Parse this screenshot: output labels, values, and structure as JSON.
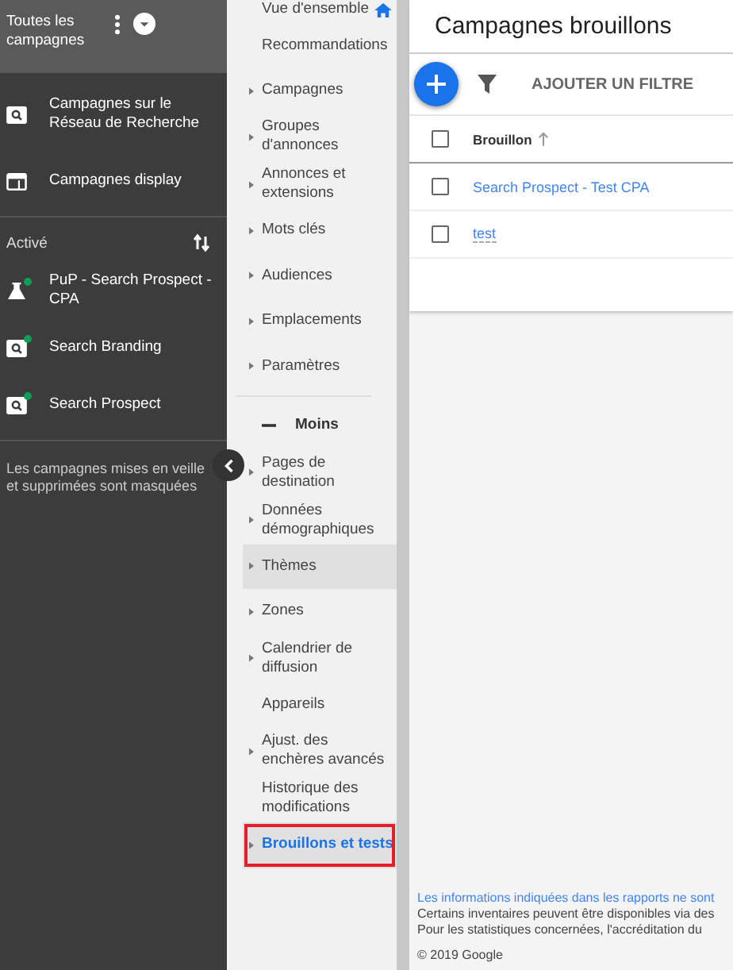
{
  "sidebar": {
    "title": "Toutes les campagnes",
    "types": [
      {
        "label": "Campagnes sur le Réseau de Recherche",
        "kind": "search"
      },
      {
        "label": "Campagnes display",
        "kind": "display"
      }
    ],
    "section": "Activé",
    "campaigns": [
      {
        "label": "PuP - Search Prospect - CPA",
        "kind": "experiment",
        "color": "#0f9d58"
      },
      {
        "label": "Search Branding",
        "kind": "search",
        "color": "#0f9d58"
      },
      {
        "label": "Search Prospect",
        "kind": "search",
        "color": "#0f9d58"
      }
    ],
    "note": "Les campagnes mises en veille et supprimées sont masquées"
  },
  "nav": {
    "items": [
      {
        "label": "Vue d'ensemble",
        "kind": "home",
        "expandable": false,
        "selected": false,
        "current": false
      },
      {
        "label": "Recommandations",
        "kind": "item",
        "expandable": false,
        "selected": false,
        "current": false
      },
      {
        "label": "Campagnes",
        "kind": "item",
        "expandable": true,
        "selected": false,
        "current": false
      },
      {
        "label": "Groupes d'annonces",
        "kind": "item",
        "expandable": true,
        "selected": false,
        "current": false
      },
      {
        "label": "Annonces et extensions",
        "kind": "item",
        "expandable": true,
        "selected": false,
        "current": false
      },
      {
        "label": "Mots clés",
        "kind": "item",
        "expandable": true,
        "selected": false,
        "current": false
      },
      {
        "label": "Audiences",
        "kind": "item",
        "expandable": true,
        "selected": false,
        "current": false
      },
      {
        "label": "Emplacements",
        "kind": "item",
        "expandable": true,
        "selected": false,
        "current": false
      },
      {
        "label": "Paramètres",
        "kind": "item",
        "expandable": true,
        "selected": false,
        "current": false
      },
      {
        "label": "Moins",
        "kind": "less",
        "expandable": false,
        "selected": false,
        "current": false
      },
      {
        "label": "Pages de destination",
        "kind": "item",
        "expandable": true,
        "selected": false,
        "current": false
      },
      {
        "label": "Données démographiques",
        "kind": "item",
        "expandable": true,
        "selected": false,
        "current": false
      },
      {
        "label": "Thèmes",
        "kind": "item",
        "expandable": true,
        "selected": true,
        "current": false
      },
      {
        "label": "Zones",
        "kind": "item",
        "expandable": true,
        "selected": false,
        "current": false
      },
      {
        "label": "Calendrier de diffusion",
        "kind": "item",
        "expandable": true,
        "selected": false,
        "current": false
      },
      {
        "label": "Appareils",
        "kind": "item",
        "expandable": false,
        "selected": false,
        "current": false
      },
      {
        "label": "Ajust. des enchères avancés",
        "kind": "item",
        "expandable": true,
        "selected": false,
        "current": false
      },
      {
        "label": "Historique des modifications",
        "kind": "item",
        "expandable": false,
        "selected": false,
        "current": false
      },
      {
        "label": "Brouillons et tests",
        "kind": "item",
        "expandable": true,
        "selected": true,
        "current": true
      }
    ]
  },
  "main": {
    "title": "Campagnes brouillons",
    "add_filter": "AJOUTER UN FILTRE",
    "table": {
      "column": "Brouillon",
      "all_checked": false,
      "rows": [
        {
          "name": "Search Prospect - Test CPA",
          "checked": false
        },
        {
          "name": "test",
          "checked": false
        }
      ]
    },
    "footer": [
      "Les informations indiquées dans les rapports ne sont",
      "Certains inventaires peuvent être disponibles via des",
      "Pour les statistiques concernées, l'accréditation du"
    ],
    "copyright": "© 2019 Google"
  }
}
